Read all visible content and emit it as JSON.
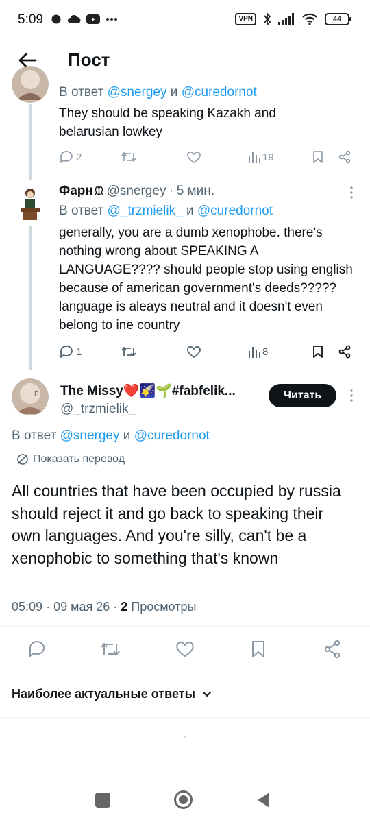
{
  "status_bar": {
    "time": "5:09",
    "vpn": "VPN",
    "battery": "44"
  },
  "header": {
    "title": "Пост"
  },
  "tweet1": {
    "reply_prefix": "В ответ",
    "mention1": "@snergey",
    "and": "и",
    "mention2": "@curedornot",
    "text": "They should be speaking Kazakh and belarusian lowkey",
    "replies": "2",
    "views": "19"
  },
  "tweet2": {
    "name": "Фарн",
    "handle": "@snergey",
    "dot": "·",
    "time": "5 мин.",
    "reply_prefix": "В ответ",
    "mention1": "@_trzmielik_",
    "and": "и",
    "mention2": "@curedornot",
    "text": "generally, you are a dumb xenophobe. there's nothing wrong about SPEAKING A LANGUAGE???? should people stop using english because of american government's deeds????? language is aleays neutral and it doesn't even belong to ine country",
    "replies": "1",
    "views": "8"
  },
  "main_tweet": {
    "name": "The Missy❤️🌠🌱#fabfelik...",
    "handle": "@_trzmielik_",
    "follow_label": "Читать",
    "reply_prefix": "В ответ",
    "mention1": "@snergey",
    "and": "и",
    "mention2": "@curedornot",
    "translate_label": "Показать перевод",
    "text": "All countries that have been occupied by russia should reject it and go back to speaking their own languages. And you're silly, can't be a xenophobic to something that's known",
    "time": "05:09",
    "dot1": "·",
    "date": "09 мая 26",
    "dot2": "·",
    "views_count": "2",
    "views_label": "Просмотры"
  },
  "replies_section": {
    "sort_label": "Наиболее актуальные ответы"
  },
  "colors": {
    "accent": "#1d9bf0",
    "text": "#0f1419",
    "muted": "#536471",
    "icon": "#8b98a5",
    "follow_bg": "#0f1419"
  },
  "icons": [
    "back-arrow-icon",
    "reply-icon",
    "retweet-icon",
    "like-icon",
    "views-icon",
    "bookmark-icon",
    "share-icon",
    "more-icon",
    "translate-icon",
    "chevron-down-icon"
  ]
}
